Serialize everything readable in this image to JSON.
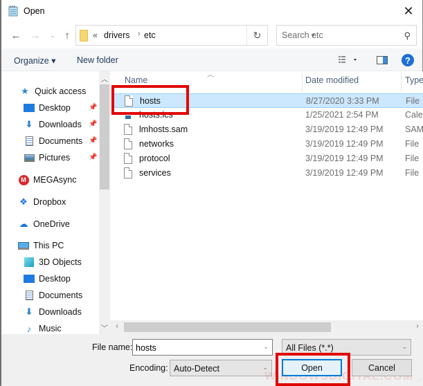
{
  "window": {
    "title": "Open",
    "close_label": "✕"
  },
  "nav": {
    "back": "back",
    "forward": "forward",
    "recent": "recent-locations",
    "up": "up"
  },
  "address": {
    "overflow": "«",
    "crumbs": [
      "drivers",
      "etc"
    ],
    "separator": "›"
  },
  "search": {
    "placeholder": "Search etc"
  },
  "toolbar": {
    "organize_label": "Organize ▾",
    "new_folder_label": "New folder",
    "help_label": "?"
  },
  "sidebar": {
    "items": [
      {
        "label": "Quick access",
        "icon": "star-icon",
        "pinned": false
      },
      {
        "label": "Desktop",
        "icon": "desktop-icon",
        "pinned": true
      },
      {
        "label": "Downloads",
        "icon": "download-icon",
        "pinned": true
      },
      {
        "label": "Documents",
        "icon": "documents-icon",
        "pinned": true
      },
      {
        "label": "Pictures",
        "icon": "pictures-icon",
        "pinned": true
      },
      {
        "label": "MEGAsync",
        "icon": "mega-icon",
        "pinned": false
      },
      {
        "label": "Dropbox",
        "icon": "dropbox-icon",
        "pinned": false
      },
      {
        "label": "OneDrive",
        "icon": "onedrive-icon",
        "pinned": false
      },
      {
        "label": "This PC",
        "icon": "pc-icon",
        "pinned": false
      },
      {
        "label": "3D Objects",
        "icon": "3d-objects-icon",
        "pinned": false
      },
      {
        "label": "Desktop",
        "icon": "desktop-icon",
        "pinned": false
      },
      {
        "label": "Documents",
        "icon": "documents-icon",
        "pinned": false
      },
      {
        "label": "Downloads",
        "icon": "download-icon",
        "pinned": false
      },
      {
        "label": "Music",
        "icon": "music-icon",
        "pinned": false
      }
    ]
  },
  "filelist": {
    "columns": {
      "name": "Name",
      "date": "Date modified",
      "type": "Type"
    },
    "rows": [
      {
        "name": "hosts",
        "date": "8/27/2020 3:33 PM",
        "type": "File",
        "selected": true
      },
      {
        "name": "hosts.ics",
        "date": "1/25/2021 2:54 PM",
        "type": "Calendar",
        "selected": false
      },
      {
        "name": "lmhosts.sam",
        "date": "3/19/2019 12:49 PM",
        "type": "SAM File",
        "selected": false
      },
      {
        "name": "networks",
        "date": "3/19/2019 12:49 PM",
        "type": "File",
        "selected": false
      },
      {
        "name": "protocol",
        "date": "3/19/2019 12:49 PM",
        "type": "File",
        "selected": false
      },
      {
        "name": "services",
        "date": "3/19/2019 12:49 PM",
        "type": "File",
        "selected": false
      }
    ]
  },
  "footer": {
    "file_name_label": "File name:",
    "file_name_value": "hosts",
    "file_type_value": "All Files  (*.*)",
    "encoding_label": "Encoding:",
    "encoding_value": "Auto-Detect",
    "open_label": "Open",
    "cancel_label": "Cancel"
  },
  "watermark": "WINDOWSDIGITAL.COM",
  "colors": {
    "highlight": "#e10600",
    "selection": "#cce8ff",
    "accent": "#0078d7"
  }
}
